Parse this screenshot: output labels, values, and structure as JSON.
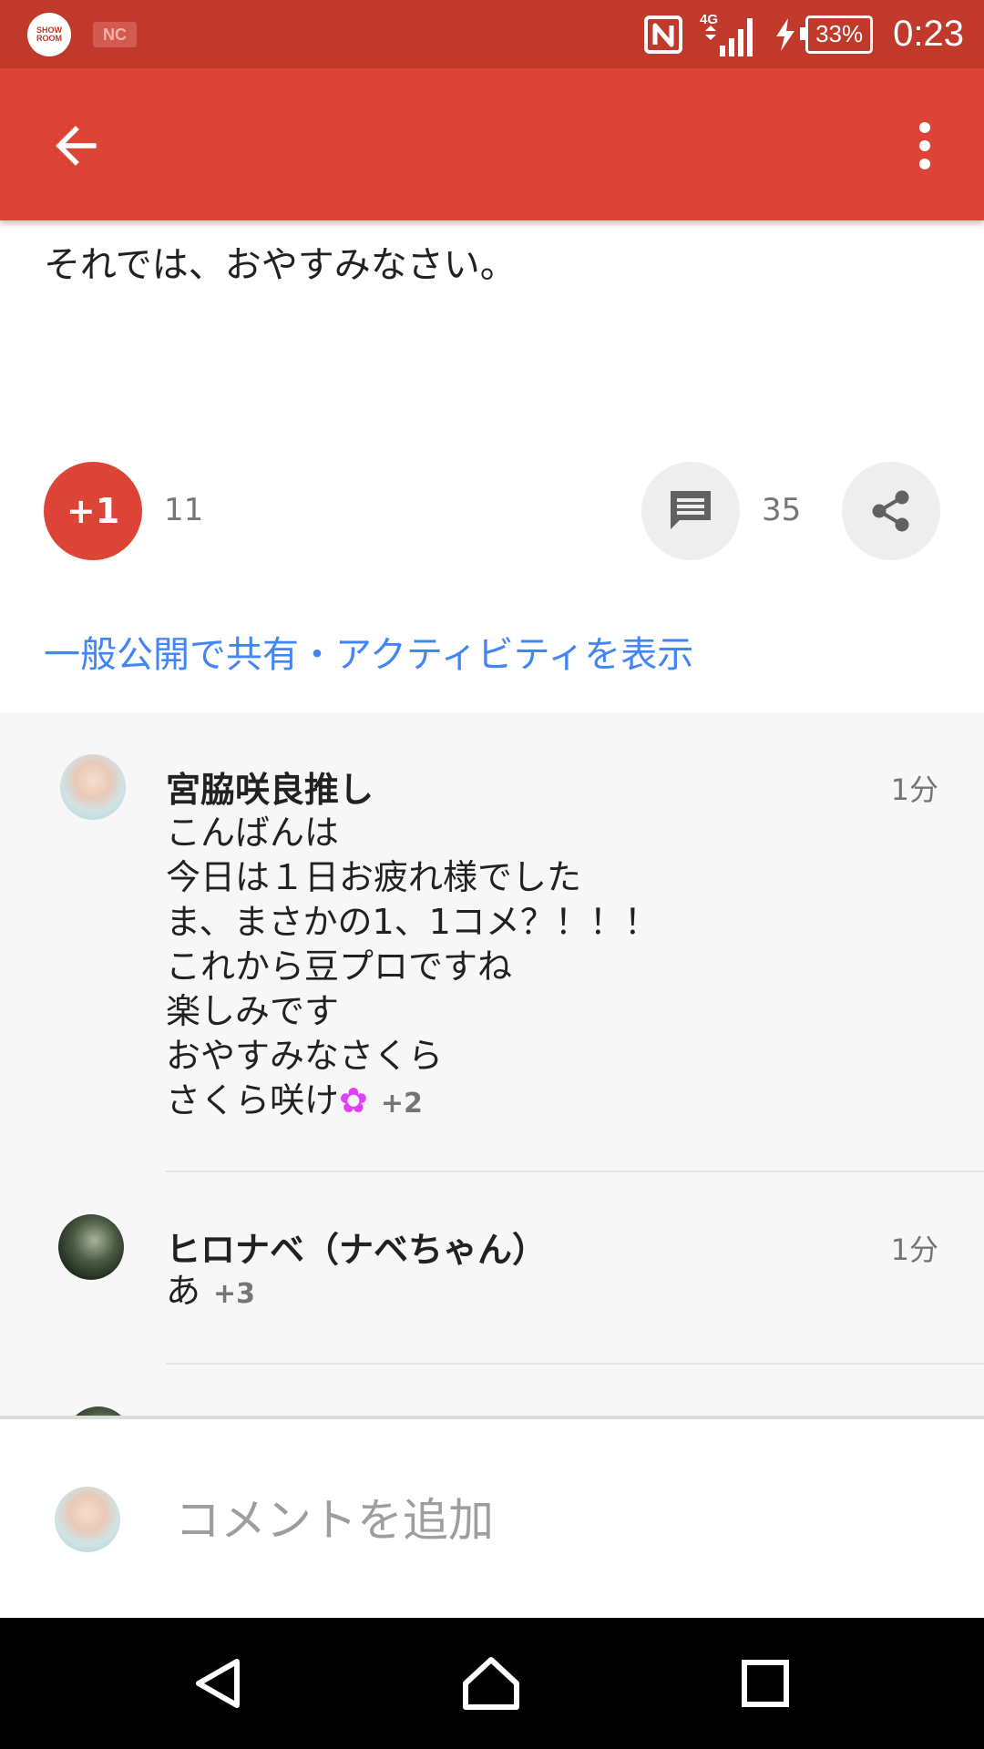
{
  "status_bar": {
    "app_icon_text": "SHOW ROOM",
    "nc_icon_text": "NC",
    "network": "4G",
    "battery": "33%",
    "time": "0:23"
  },
  "app_bar": {
    "back_icon": "arrow-back-icon",
    "more_icon": "more-vert-icon"
  },
  "post": {
    "text": "それでは、おやすみなさい。",
    "plus_one_label": "+1",
    "plus_one_count": "11",
    "comment_count": "35",
    "activity_link": "一般公開で共有・アクティビティを表示"
  },
  "comments": [
    {
      "author": "宮脇咲良推し",
      "time": "1分",
      "lines": [
        "こんばんは",
        "今日は１日お疲れ様でした",
        "ま、まさかの1、1コメ？！！！",
        "これから豆プロですね",
        "楽しみです",
        "おやすみなさくら",
        "さくら咲け"
      ],
      "emoji": "✿",
      "plus": "+2"
    },
    {
      "author": "ヒロナベ（ナベちゃん）",
      "time": "1分",
      "lines": [
        "あ"
      ],
      "plus": "+3"
    }
  ],
  "add_comment": {
    "placeholder": "コメントを追加"
  },
  "colors": {
    "status_bar": "#c0392b",
    "app_bar": "#db4437",
    "link": "#4285f4"
  }
}
